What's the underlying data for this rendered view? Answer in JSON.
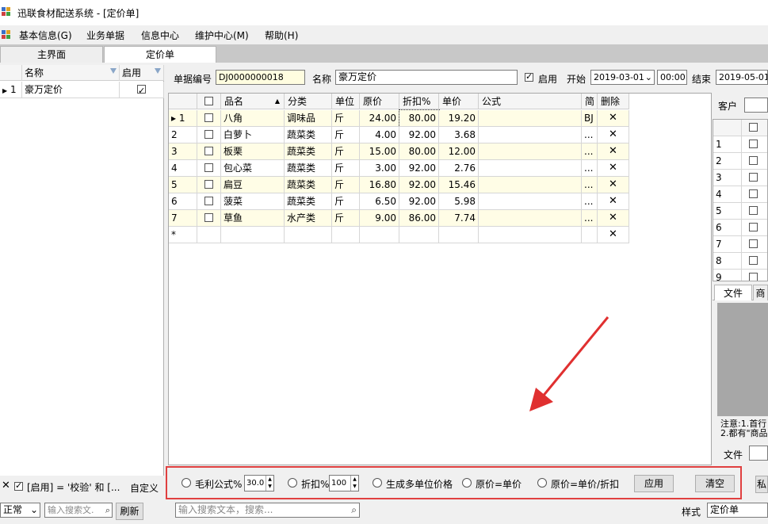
{
  "window": {
    "title": "迅联食材配送系统 - [定价单]"
  },
  "menu": [
    "基本信息(G)",
    "业务单据",
    "信息中心",
    "维护中心(M)",
    "帮助(H)"
  ],
  "tabs": [
    "主界面",
    "定价单"
  ],
  "left_list": {
    "headers": [
      "名称",
      "启用"
    ],
    "rows": [
      {
        "index": "1",
        "name": "豪万定价",
        "enabled": true
      }
    ],
    "filter_text": "[启用] = '校验' 和 [...",
    "customize": "自定义",
    "status_select": "正常",
    "search_placeholder": "输入搜索文.",
    "refresh": "刷新"
  },
  "form": {
    "doc_no_label": "单据编号",
    "doc_no": "DJ0000000018",
    "name_label": "名称",
    "name": "豪万定价",
    "enable_label": "启用",
    "start_label": "开始",
    "start_date": "2019-03-01",
    "start_time": "00:00",
    "end_label": "结束",
    "end_date": "2019-05-01"
  },
  "grid": {
    "headers": [
      "",
      "品名",
      "分类",
      "单位",
      "原价",
      "折扣%",
      "单价",
      "公式",
      "简",
      "删除"
    ],
    "rows": [
      {
        "idx": "1",
        "name": "八角",
        "cat": "调味品",
        "unit": "斤",
        "orig": "24.00",
        "disc": "80.00",
        "price": "19.20",
        "abbr": "BJ",
        "del": "✕"
      },
      {
        "idx": "2",
        "name": "白萝卜",
        "cat": "蔬菜类",
        "unit": "斤",
        "orig": "4.00",
        "disc": "92.00",
        "price": "3.68",
        "abbr": "...",
        "del": "✕"
      },
      {
        "idx": "3",
        "name": "板栗",
        "cat": "蔬菜类",
        "unit": "斤",
        "orig": "15.00",
        "disc": "80.00",
        "price": "12.00",
        "abbr": "...",
        "del": "✕"
      },
      {
        "idx": "4",
        "name": "包心菜",
        "cat": "蔬菜类",
        "unit": "斤",
        "orig": "3.00",
        "disc": "92.00",
        "price": "2.76",
        "abbr": "...",
        "del": "✕"
      },
      {
        "idx": "5",
        "name": "扁豆",
        "cat": "蔬菜类",
        "unit": "斤",
        "orig": "16.80",
        "disc": "92.00",
        "price": "15.46",
        "abbr": "...",
        "del": "✕"
      },
      {
        "idx": "6",
        "name": "菠菜",
        "cat": "蔬菜类",
        "unit": "斤",
        "orig": "6.50",
        "disc": "92.00",
        "price": "5.98",
        "abbr": "...",
        "del": "✕"
      },
      {
        "idx": "7",
        "name": "草鱼",
        "cat": "水产类",
        "unit": "斤",
        "orig": "9.00",
        "disc": "86.00",
        "price": "7.74",
        "abbr": "...",
        "del": "✕"
      }
    ],
    "new_row_marker": "*",
    "new_row_del": "✕",
    "search_placeholder": "输入搜索文本，搜索..."
  },
  "right_panel": {
    "customer_label": "客户",
    "row_indices": [
      "1",
      "2",
      "3",
      "4",
      "5",
      "6",
      "7",
      "8",
      "9"
    ],
    "tabs": [
      "文件",
      "商品"
    ],
    "note_line1": "注意:1.首行",
    "note_line2": "2.都有\"商品",
    "file_label": "文件",
    "style_label": "样式",
    "style_value": "定价单"
  },
  "options": {
    "gross_label": "毛利公式%",
    "gross_value": "30.0",
    "disc_label": "折扣%",
    "disc_value": "100",
    "multi_label": "生成多单位价格",
    "orig_eq_price": "原价=单价",
    "orig_eq_price_disc": "原价=单价/折扣",
    "apply": "应用",
    "clear": "清空",
    "cut_btn": "私"
  },
  "colors": {
    "highlight_box": "#e04040",
    "row_tint": "#fffde6",
    "arrow": "#e03030"
  }
}
